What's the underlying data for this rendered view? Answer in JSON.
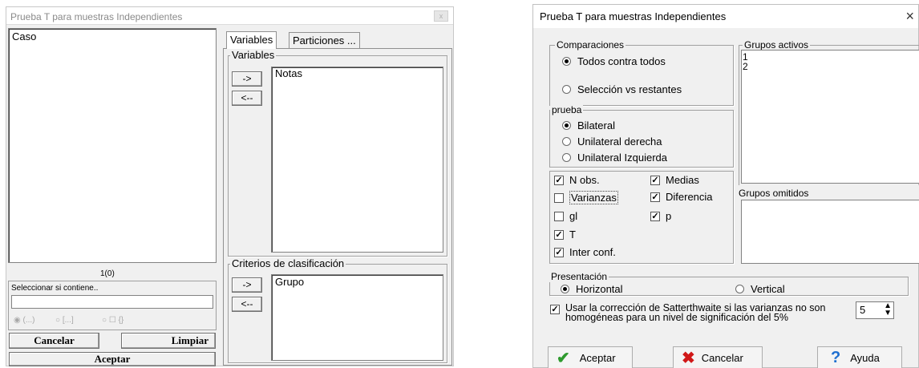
{
  "left_dialog": {
    "title": "Prueba T para muestras Independientes",
    "close_glyph": "x",
    "source_list": [
      "Caso"
    ],
    "count_label": "1(0)",
    "filter_label": "Seleccionar si contiene..",
    "filter_value": "",
    "filter_options": [
      "(...)",
      "[...]",
      "{}"
    ],
    "cancel_label": "Cancelar",
    "clear_label": "Limpiar",
    "accept_label": "Aceptar",
    "tabs": [
      "Variables",
      "Particiones ..."
    ],
    "variables_group": "Variables",
    "variables_list": [
      "Notas"
    ],
    "criteria_group": "Criterios de clasificación",
    "criteria_list": [
      "Grupo"
    ],
    "add_arrow": "->",
    "remove_arrow": "<--"
  },
  "right_dialog": {
    "title": "Prueba T para muestras Independientes",
    "close_glyph": "×",
    "comparisons": {
      "label": "Comparaciones",
      "options": [
        "Todos contra todos",
        "Selección vs restantes"
      ],
      "selected": 0
    },
    "active_groups": {
      "label": "Grupos activos",
      "items": [
        "1",
        "2"
      ]
    },
    "omitted_groups": {
      "label": "Grupos omitidos",
      "items": []
    },
    "test": {
      "label": "prueba",
      "options": [
        "Bilateral",
        "Unilateral derecha",
        "Unilateral Izquierda"
      ],
      "selected": 0
    },
    "stats": {
      "n_obs": {
        "label": "N obs.",
        "checked": true
      },
      "means": {
        "label": "Medias",
        "checked": true
      },
      "variances": {
        "label": "Varianzas",
        "checked": false
      },
      "difference": {
        "label": "Diferencia",
        "checked": true
      },
      "df": {
        "label": "gl",
        "checked": false
      },
      "p": {
        "label": "p",
        "checked": true
      },
      "t": {
        "label": "T",
        "checked": true
      },
      "ci": {
        "label": "Inter conf.",
        "checked": true
      }
    },
    "presentation": {
      "label": "Presentación",
      "options": [
        "Horizontal",
        "Vertical"
      ],
      "selected": 0
    },
    "satterthwaite": {
      "checked": true,
      "text": "Usar la corrección de Satterthwaite si las varianzas no son homogéneas para un nivel de significación del 5%",
      "value": "5"
    },
    "buttons": {
      "accept": "Aceptar",
      "cancel": "Cancelar",
      "help": "Ayuda"
    },
    "colors": {
      "accept_icon": "#2e9a2e",
      "cancel_icon": "#d01818",
      "help_icon": "#1e6fd0"
    }
  }
}
